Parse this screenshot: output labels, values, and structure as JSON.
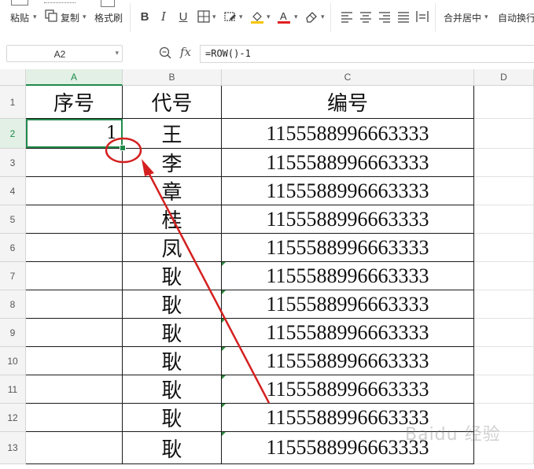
{
  "toolbar": {
    "paste_label": "粘贴",
    "copy_label": "复制",
    "format_painter_label": "格式刷",
    "merge_center_label": "合并居中",
    "auto_wrap_label": "自动换行",
    "bold": "B",
    "italic": "I",
    "underline": "U",
    "font_color_letter": "A"
  },
  "formula_bar": {
    "name_box": "A2",
    "fx": "fx",
    "formula": "=ROW()-1"
  },
  "sheet": {
    "columns": [
      "A",
      "B",
      "C",
      "D"
    ],
    "active_column": "A",
    "rows": [
      "1",
      "2",
      "3",
      "4",
      "5",
      "6",
      "7",
      "8",
      "9",
      "10",
      "11",
      "12",
      "13"
    ],
    "active_row": "2",
    "header": {
      "a": "序号",
      "b": "代号",
      "c": "编号"
    },
    "data": [
      {
        "a": "1",
        "b": "王",
        "c": "1155588996663333"
      },
      {
        "a": "",
        "b": "李",
        "c": "1155588996663333"
      },
      {
        "a": "",
        "b": "章",
        "c": "1155588996663333"
      },
      {
        "a": "",
        "b": "桂",
        "c": "1155588996663333"
      },
      {
        "a": "",
        "b": "凤",
        "c": "1155588996663333"
      },
      {
        "a": "",
        "b": "耿",
        "c": "1155588996663333"
      },
      {
        "a": "",
        "b": "耿",
        "c": "1155588996663333"
      },
      {
        "a": "",
        "b": "耿",
        "c": "1155588996663333"
      },
      {
        "a": "",
        "b": "耿",
        "c": "1155588996663333"
      },
      {
        "a": "",
        "b": "耿",
        "c": "1155588996663333"
      },
      {
        "a": "",
        "b": "耿",
        "c": "1155588996663333"
      },
      {
        "a": "",
        "b": "耿",
        "c": "1155588996663333"
      }
    ]
  },
  "colors": {
    "selection": "#1f8a4a",
    "annotation": "#d42020",
    "font_color_bar": "#e02020",
    "fill_color_bar": "#f5c400"
  },
  "watermark": "Baidu 经验"
}
